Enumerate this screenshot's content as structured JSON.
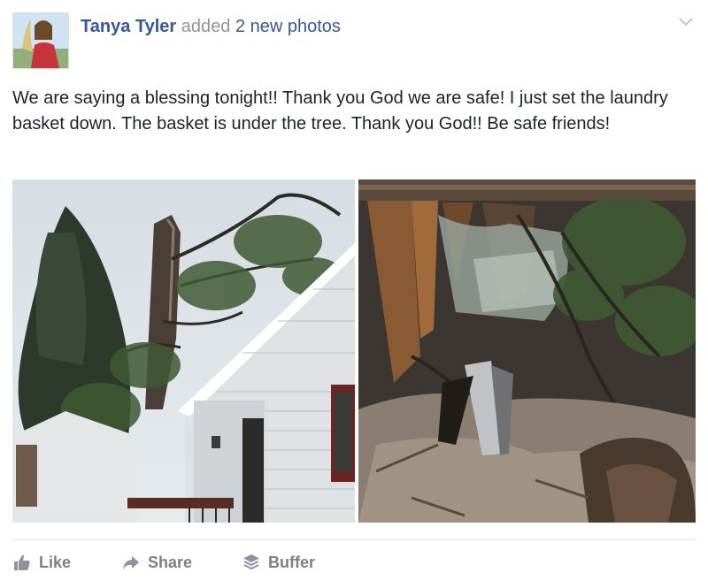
{
  "post": {
    "author": "Tanya Tyler",
    "action_text": "added",
    "photos_link": "2 new photos",
    "body": "We are saying a blessing tonight!! Thank you God we are safe! I just set the laundry basket down. The basket is under the tree. Thank you God!! Be safe friends!",
    "photos": [
      {
        "icon": "photo-tree-on-house"
      },
      {
        "icon": "photo-damaged-interior"
      }
    ],
    "actions": {
      "like_label": "Like",
      "share_label": "Share",
      "buffer_label": "Buffer"
    }
  },
  "colors": {
    "link": "#365899",
    "meta_text": "#90949c",
    "body_text": "#1d2129",
    "action_text": "#7f7f7f",
    "divider": "#dddfe2"
  },
  "icons": {
    "menu": "chevron-down-icon",
    "like": "thumbs-up-icon",
    "share": "share-arrow-icon",
    "buffer": "buffer-stack-icon"
  }
}
